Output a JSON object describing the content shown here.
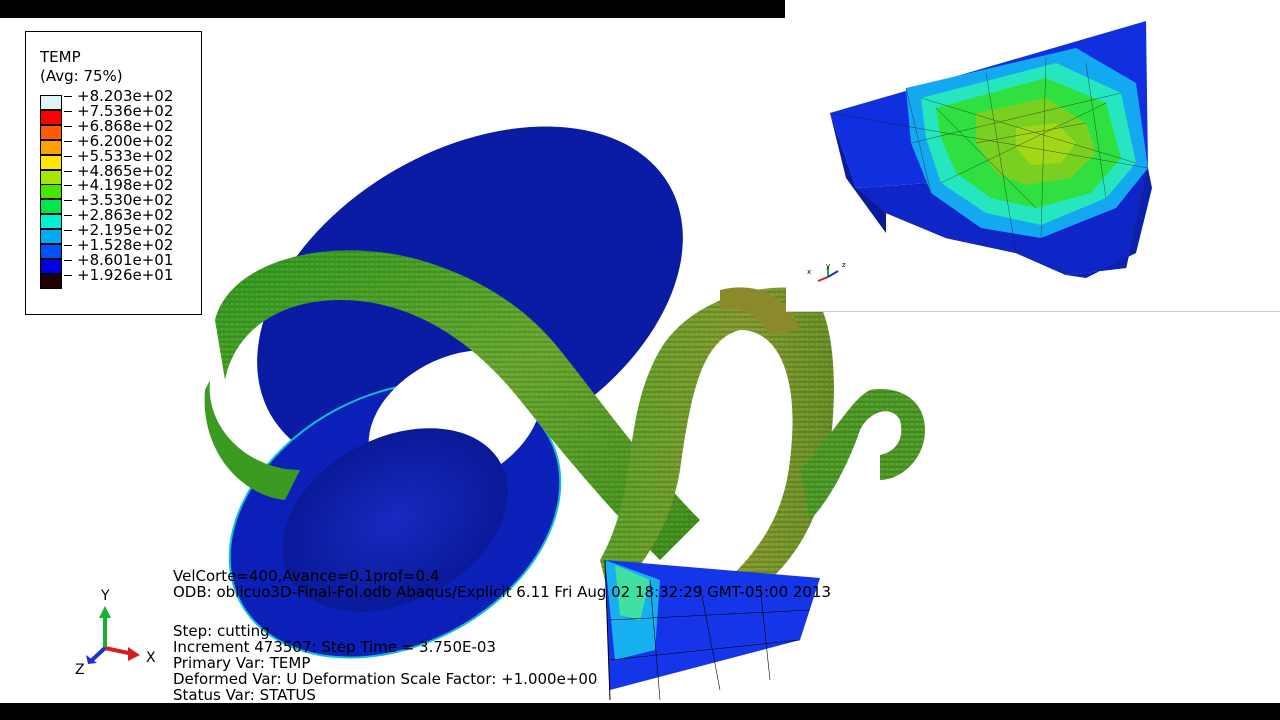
{
  "legend": {
    "title": "TEMP",
    "subtitle": "(Avg: 75%)",
    "entries": [
      {
        "label": "+8.203e+02",
        "color": "#e0f4f4"
      },
      {
        "label": "+7.536e+02",
        "color": "#ff0000"
      },
      {
        "label": "+6.868e+02",
        "color": "#ff5a00"
      },
      {
        "label": "+6.200e+02",
        "color": "#ffa000"
      },
      {
        "label": "+5.533e+02",
        "color": "#ffe600"
      },
      {
        "label": "+4.865e+02",
        "color": "#a8e600"
      },
      {
        "label": "+4.198e+02",
        "color": "#46e600"
      },
      {
        "label": "+3.530e+02",
        "color": "#00e64b"
      },
      {
        "label": "+2.863e+02",
        "color": "#00f0d2"
      },
      {
        "label": "+2.195e+02",
        "color": "#00aaf0"
      },
      {
        "label": "+1.528e+02",
        "color": "#0050ff"
      },
      {
        "label": "+8.601e+01",
        "color": "#0000e6"
      },
      {
        "label": "+1.926e+01",
        "color": "#200000"
      }
    ]
  },
  "info": {
    "line1": "VelCorte=400,Avance=0.1prof=0.4",
    "line2": "ODB: oblicuo3D-Final-Fol.odb    Abaqus/Explicit 6.11    Fri Aug 02 18:32:29 GMT-05:00 2013",
    "step": "Step: cutting",
    "increment": "Increment    473507: Step Time =    3.750E-03",
    "primary": "Primary Var: TEMP",
    "deformed": "Deformed Var: U   Deformation Scale Factor: +1.000e+00",
    "status": "Status Var: STATUS"
  },
  "triad": {
    "y": "Y",
    "x": "X",
    "z": "Z"
  },
  "mini_triad": {
    "x": "x",
    "y": "y",
    "z": "z"
  },
  "colors": {
    "workpiece_blue": "#0a1fb0",
    "chip_green": "#3ca81e",
    "tool_blue": "#1030e0"
  }
}
